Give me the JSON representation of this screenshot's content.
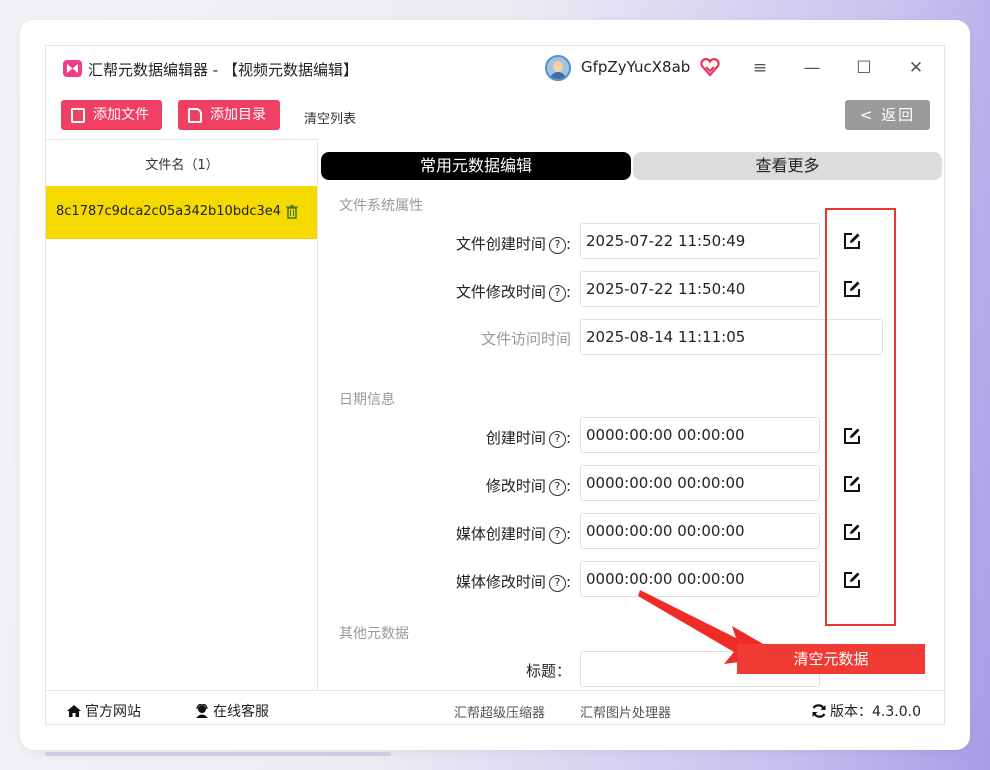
{
  "window": {
    "title": "汇帮元数据编辑器 - 【视频元数据编辑】",
    "username": "GfpZyYucX8ab",
    "controls": {
      "menu": "≡",
      "minimize": "—",
      "maximize": "☐",
      "close": "✕"
    }
  },
  "toolbar": {
    "add_file": "添加文件",
    "add_dir": "添加目录",
    "clear_list": "清空列表",
    "back": "< 返回"
  },
  "file_list": {
    "header": "文件名（1）",
    "items": [
      {
        "name": "8c1787c9dca2c05a342b10bdc3e4"
      }
    ]
  },
  "tabs": {
    "common": "常用元数据编辑",
    "more": "查看更多"
  },
  "sections": {
    "fs": "文件系统属性",
    "date": "日期信息",
    "other": "其他元数据"
  },
  "fields": {
    "fs_created": {
      "label": "文件创建时间",
      "value": "2025-07-22 11:50:49"
    },
    "fs_modified": {
      "label": "文件修改时间",
      "value": "2025-07-22 11:50:40"
    },
    "fs_accessed": {
      "label": "文件访问时间",
      "value": "2025-08-14 11:11:05"
    },
    "created": {
      "label": "创建时间",
      "value": "0000:00:00 00:00:00"
    },
    "modified": {
      "label": "修改时间",
      "value": "0000:00:00 00:00:00"
    },
    "media_created": {
      "label": "媒体创建时间",
      "value": "0000:00:00 00:00:00"
    },
    "media_modified": {
      "label": "媒体修改时间",
      "value": "0000:00:00 00:00:00"
    },
    "title": {
      "label": "标题：",
      "value": ""
    }
  },
  "help_mark": "?",
  "colon": ":",
  "clear_metadata": "清空元数据",
  "footer": {
    "website": "官方网站",
    "service": "在线客服",
    "compressor": "汇帮超级压缩器",
    "image_tool": "汇帮图片处理器",
    "version": "版本：4.3.0.0"
  },
  "colors": {
    "accent": "#ef3f63",
    "selected_row": "#f5d900",
    "annotation": "#e53935"
  }
}
